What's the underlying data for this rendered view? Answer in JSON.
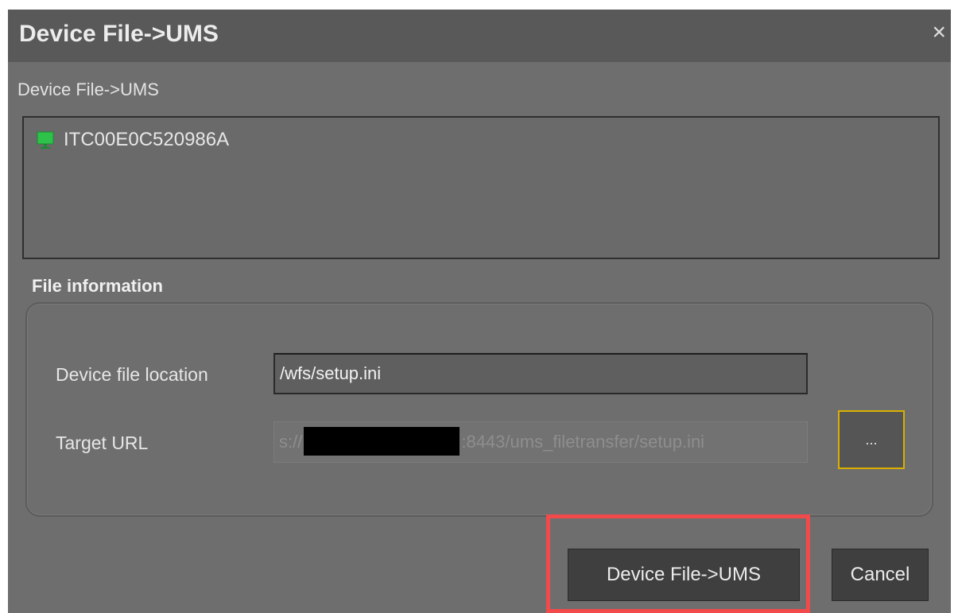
{
  "dialog": {
    "title": "Device File->UMS",
    "close_label": "×",
    "subtitle": "Device File->UMS"
  },
  "device_list": {
    "items": [
      {
        "name": "ITC00E0C520986A",
        "icon": "monitor-icon"
      }
    ]
  },
  "file_info": {
    "section_label": "File information",
    "device_file_location_label": "Device file location",
    "device_file_location_value": "/wfs/setup.ini",
    "target_url_label": "Target URL",
    "target_url_prefix": "s://",
    "target_url_suffix": ":8443/ums_filetransfer/setup.ini",
    "browse_label": "..."
  },
  "buttons": {
    "confirm_label": "Device File->UMS",
    "cancel_label": "Cancel"
  },
  "colors": {
    "dialog_bg": "#6e6e6e",
    "titlebar_bg": "#595959",
    "focus_accent": "#d9b000",
    "highlight": "#f24a4a",
    "monitor_icon": "#2ec24a"
  }
}
